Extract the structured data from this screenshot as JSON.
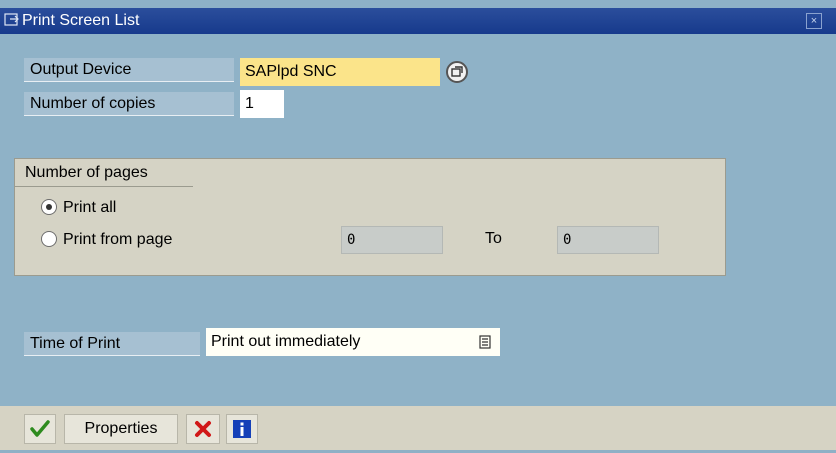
{
  "window": {
    "title": "Print Screen List",
    "icons": {
      "app": "print-list-icon",
      "close": "close-icon"
    }
  },
  "form": {
    "output_device": {
      "label": "Output Device",
      "value": "SAPlpd SNC"
    },
    "copies": {
      "label": "Number of copies",
      "value": "1"
    },
    "pages_group": {
      "title": "Number of pages",
      "print_all": {
        "label": "Print all",
        "checked": true
      },
      "print_from": {
        "label": "Print from page",
        "checked": false
      },
      "from_value": "0",
      "to_label": "To",
      "to_value": "0"
    },
    "time_of_print": {
      "label": "Time of Print",
      "value": "Print out immediately"
    }
  },
  "toolbar": {
    "properties_label": "Properties",
    "icons": [
      "checkmark-icon",
      "cancel-x-icon",
      "info-icon"
    ]
  },
  "colors": {
    "background": "#8fb2c7",
    "titlebar": "#1f4595",
    "required_field": "#fbe48a",
    "group_bg": "#d5d3c5"
  }
}
